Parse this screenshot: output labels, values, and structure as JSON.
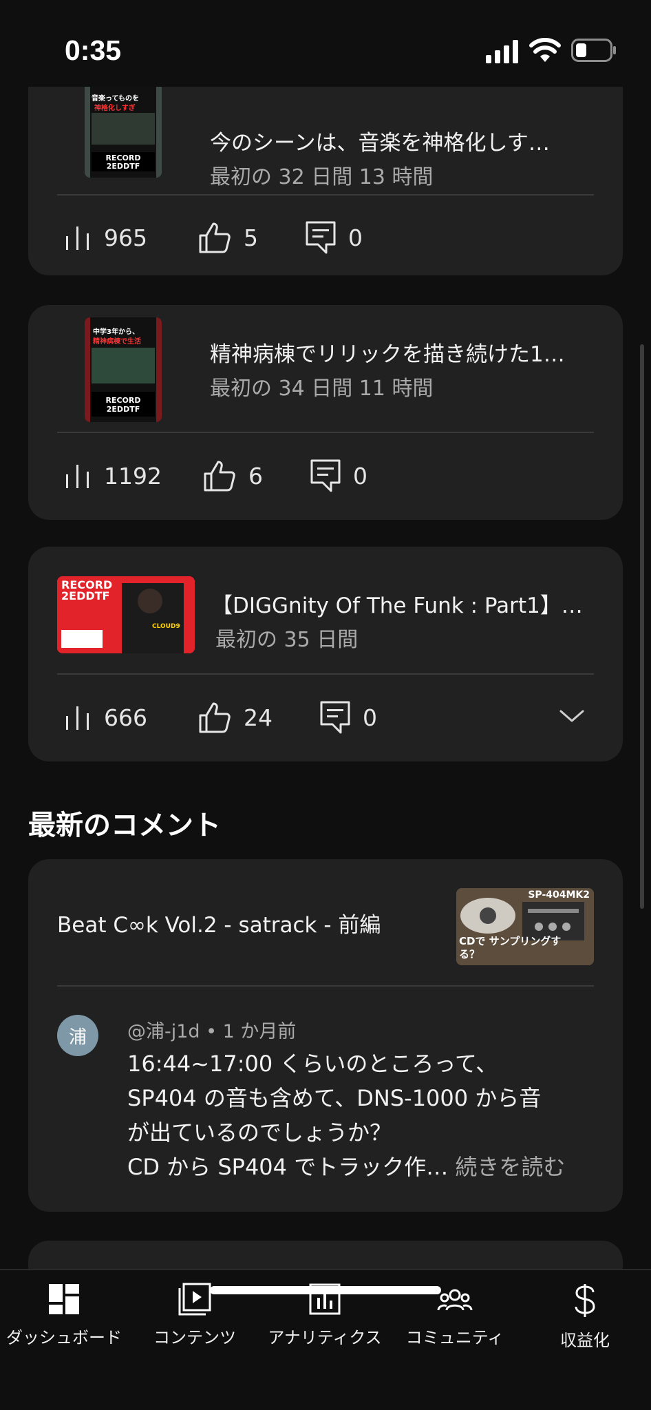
{
  "status_bar": {
    "time": "0:35"
  },
  "videos": [
    {
      "title": "今のシーンは、音楽を神格化しす…",
      "subtitle": "最初の 32 日間 13 時間",
      "views": "965",
      "likes": "5",
      "comments": "0",
      "thumb_text_top": "音楽ってものを",
      "thumb_text_red": "神格化しすぎ",
      "thumb_brand": "RECORD\n2EDDTF"
    },
    {
      "title": "精神病棟でリリックを描き続けた1…",
      "subtitle": "最初の 34 日間 11 時間",
      "views": "1192",
      "likes": "6",
      "comments": "0",
      "thumb_text_top": "中学3年から、",
      "thumb_text_red": "精神病棟で生活",
      "thumb_brand": "RECORD\n2EDDTF"
    },
    {
      "title": "【DIGGnity Of The Funk : Part1】…",
      "subtitle": "最初の 35 日間",
      "views": "666",
      "likes": "24",
      "comments": "0",
      "thumb_brand": "RECORD\n2EDDTF",
      "thumb_tag": "CLOUD9"
    }
  ],
  "latest_comments": {
    "section_title": "最新のコメント",
    "items": [
      {
        "video_title": "Beat C∞k Vol.2 - satrack -  前編",
        "thumb_text_top": "SP-404MK2",
        "thumb_text_bottom": "CDで サンプリングする？",
        "avatar_char": "浦",
        "author": "@浦-j1d",
        "time": "1 か月前",
        "lines": [
          "16:44~17:00 くらいのところって、",
          "SP404 の音も含めて、DNS-1000 から音",
          "が出ているのでしょうか？",
          "CD から SP404 でトラック作…"
        ],
        "read_more": "続きを読む"
      }
    ]
  },
  "bottom_nav": [
    {
      "label": "ダッシュボード",
      "icon": "dashboard-icon"
    },
    {
      "label": "コンテンツ",
      "icon": "content-icon"
    },
    {
      "label": "アナリティクス",
      "icon": "analytics-icon"
    },
    {
      "label": "コミュニティ",
      "icon": "community-icon"
    },
    {
      "label": "収益化",
      "icon": "dollar-icon"
    }
  ],
  "colors": {
    "background": "#0f0f0f",
    "card": "#212121",
    "secondary_text": "#aaaaaa",
    "avatar": "#7e98a8"
  }
}
